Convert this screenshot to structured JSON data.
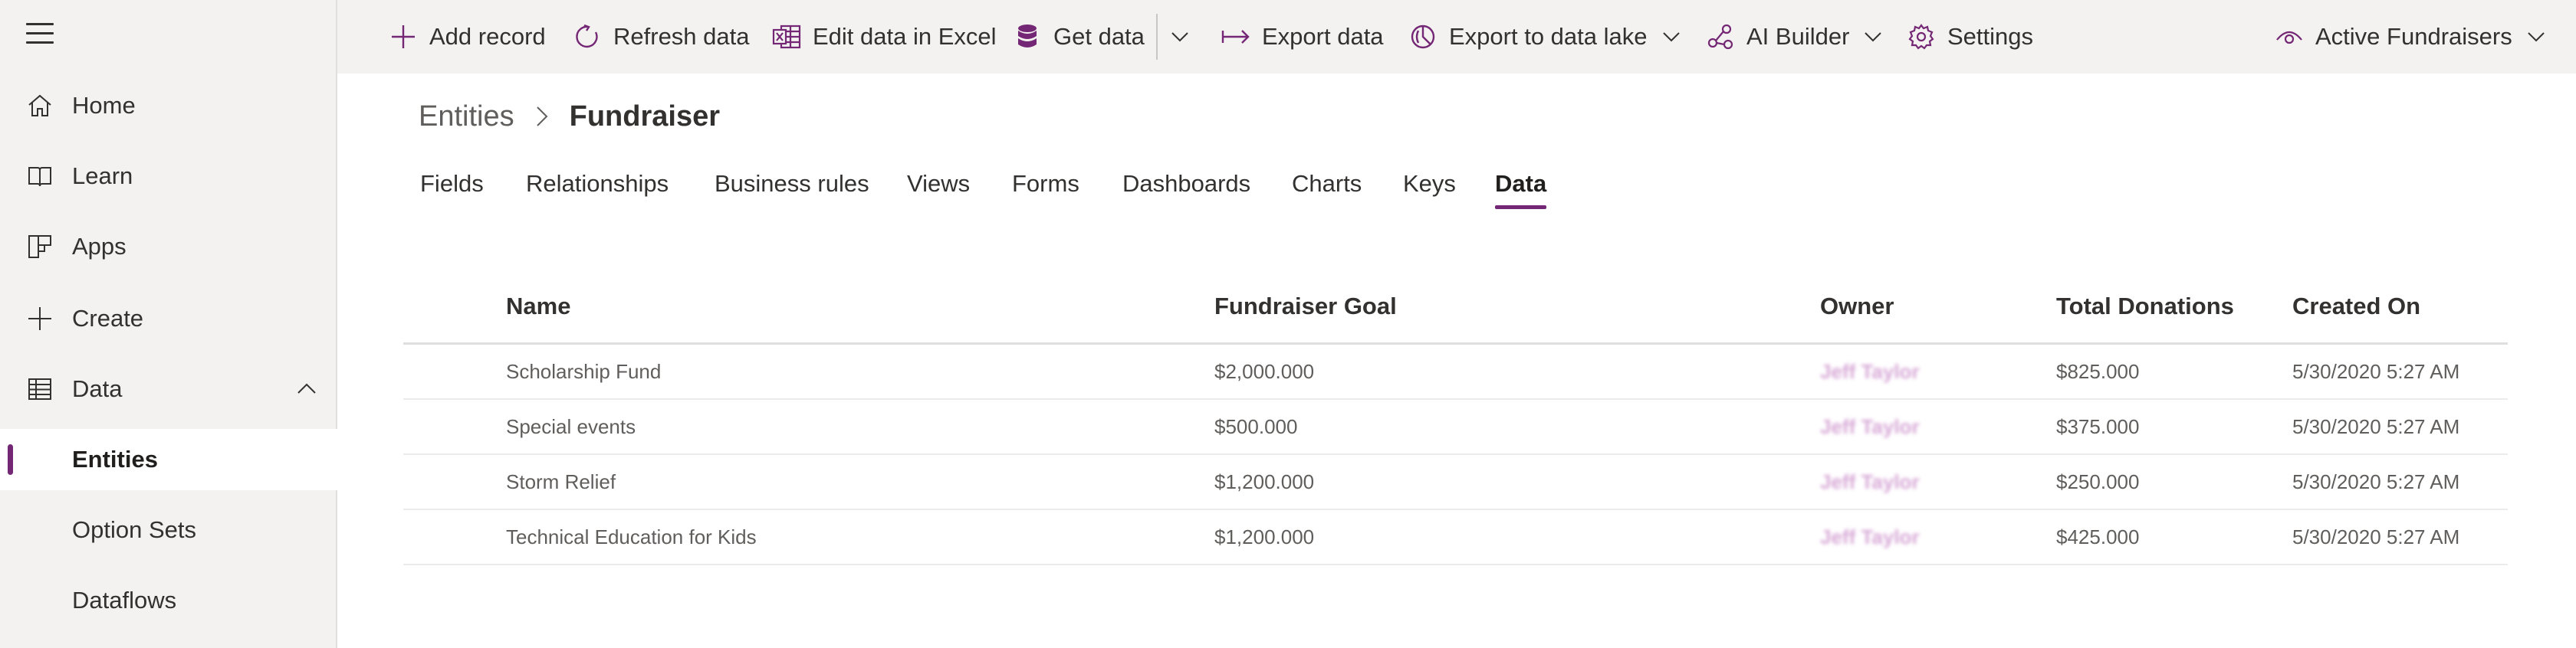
{
  "sidebar": {
    "items": [
      {
        "label": "Home",
        "icon": "home-icon"
      },
      {
        "label": "Learn",
        "icon": "book-icon"
      },
      {
        "label": "Apps",
        "icon": "apps-icon"
      },
      {
        "label": "Create",
        "icon": "plus-icon"
      },
      {
        "label": "Data",
        "icon": "table-icon",
        "expanded": true
      },
      {
        "label": "Entities"
      },
      {
        "label": "Option Sets"
      },
      {
        "label": "Dataflows"
      }
    ]
  },
  "commandbar": {
    "add_record": "Add record",
    "refresh_data": "Refresh data",
    "edit_in_excel": "Edit data in Excel",
    "get_data": "Get data",
    "export_data": "Export data",
    "export_to_data_lake": "Export to data lake",
    "ai_builder": "AI Builder",
    "settings": "Settings",
    "view_selector": "Active Fundraisers"
  },
  "breadcrumb": {
    "parent": "Entities",
    "current": "Fundraiser"
  },
  "tabs": [
    "Fields",
    "Relationships",
    "Business rules",
    "Views",
    "Forms",
    "Dashboards",
    "Charts",
    "Keys",
    "Data"
  ],
  "active_tab": "Data",
  "table": {
    "columns": [
      "Name",
      "Fundraiser Goal",
      "Owner",
      "Total Donations",
      "Created On"
    ],
    "rows": [
      {
        "name": "Scholarship Fund",
        "goal": "$2,000.000",
        "owner": "Jeff Taylor",
        "donations": "$825.000",
        "created": "5/30/2020 5:27 AM"
      },
      {
        "name": "Special events",
        "goal": "$500.000",
        "owner": "Jeff Taylor",
        "donations": "$375.000",
        "created": "5/30/2020 5:27 AM"
      },
      {
        "name": "Storm Relief",
        "goal": "$1,200.000",
        "owner": "Jeff Taylor",
        "donations": "$250.000",
        "created": "5/30/2020 5:27 AM"
      },
      {
        "name": "Technical Education for Kids",
        "goal": "$1,200.000",
        "owner": "Jeff Taylor",
        "donations": "$425.000",
        "created": "5/30/2020 5:27 AM"
      }
    ]
  },
  "colors": {
    "accent": "#742774",
    "sidebar_bg": "#f3f2f1",
    "owner_blurred": "#d7a8d6"
  }
}
